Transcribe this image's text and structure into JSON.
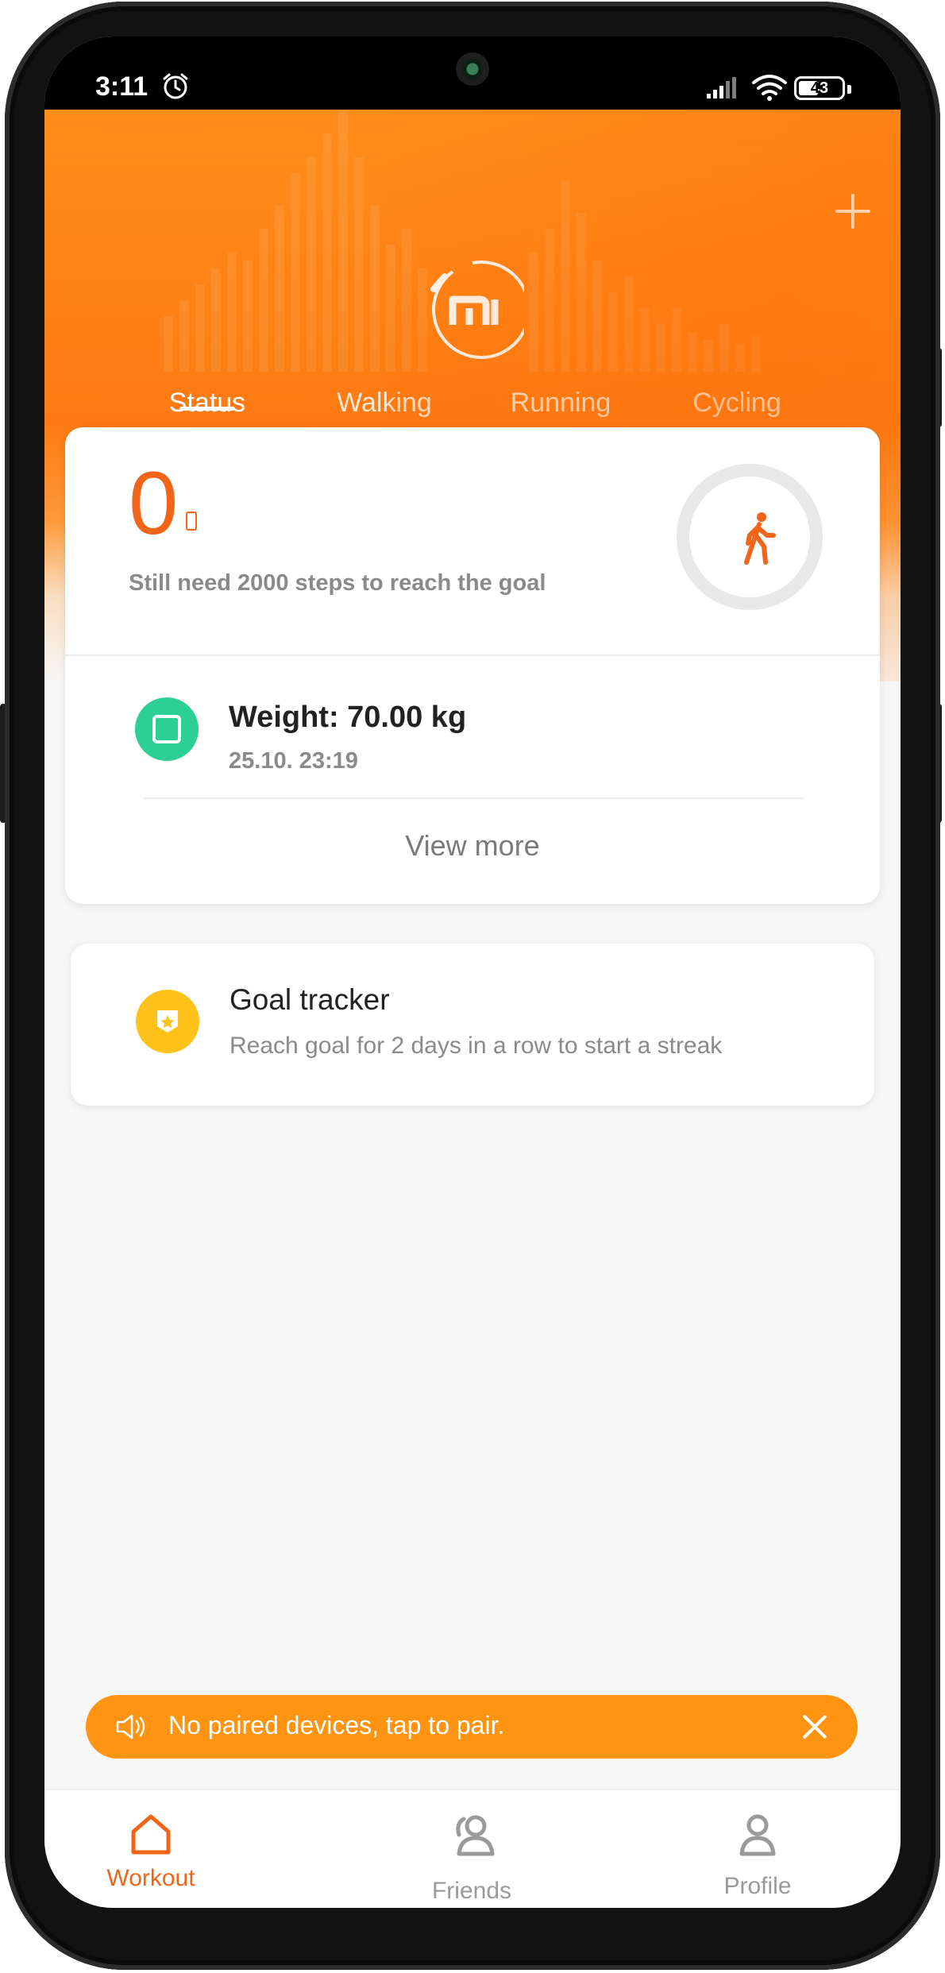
{
  "status_bar": {
    "time": "3:11",
    "battery": "43",
    "icons": [
      "alarm-icon",
      "signal-icon",
      "wifi-icon",
      "battery-icon"
    ]
  },
  "header": {
    "logo": "MI",
    "add_icon": "plus-icon",
    "tabs": [
      {
        "label": "Status",
        "active": true
      },
      {
        "label": "Walking",
        "active": false
      },
      {
        "label": "Running",
        "active": false
      },
      {
        "label": "Cycling",
        "active": false
      }
    ]
  },
  "steps_card": {
    "steps": "0",
    "subtitle": "Still need 2000 steps to reach the goal",
    "icon": "walking-person-icon"
  },
  "weight": {
    "title": "Weight: 70.00 kg",
    "date": "25.10. 23:19",
    "icon": "scale-icon"
  },
  "view_more": "View more",
  "goal_tracker": {
    "title": "Goal tracker",
    "subtitle": "Reach goal for 2 days in a row to start a streak",
    "icon": "badge-star-icon"
  },
  "toast": {
    "text": "No paired devices, tap to pair."
  },
  "bottom_nav": [
    {
      "label": "Workout",
      "active": true
    },
    {
      "label": "Friends",
      "active": false
    },
    {
      "label": "Profile",
      "active": false
    }
  ],
  "colors": {
    "accent": "#f26418",
    "header_orange": "#fc7a12",
    "toast_orange": "#ff9412",
    "weight_green": "#2ccf94",
    "goal_yellow": "#ffc21a",
    "inactive_gray": "#9a9a9a"
  }
}
